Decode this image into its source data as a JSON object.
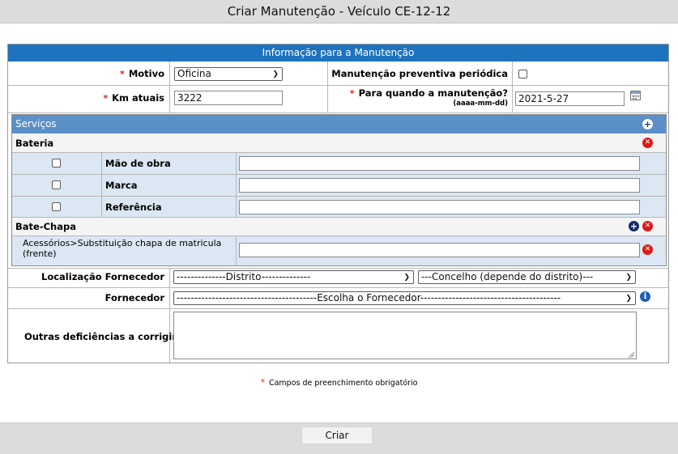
{
  "title": "Criar Manutenção - Veículo CE-12-12",
  "section_header": "Informação para a Manutenção",
  "required_mark": "*",
  "motivo": {
    "label": "Motivo",
    "value": "Oficina"
  },
  "preventiva": {
    "label": "Manutenção preventiva periódica",
    "checked": false
  },
  "km": {
    "label": "Km atuais",
    "value": "3222"
  },
  "data_prevista": {
    "label": "Para quando a manutenção?",
    "format_hint": "(aaaa-mm-dd)",
    "value": "2021-5-27"
  },
  "servicos": {
    "header": "Serviços",
    "groups": [
      {
        "name": "Bateria",
        "items": [
          {
            "label": "Mão de obra",
            "value": ""
          },
          {
            "label": "Marca",
            "value": ""
          },
          {
            "label": "Referência",
            "value": ""
          }
        ]
      },
      {
        "name": "Bate-Chapa",
        "items": [
          {
            "label": "Acessórios>Substituição chapa de matricula (frente)",
            "value": ""
          }
        ]
      }
    ]
  },
  "localizacao": {
    "label": "Localização Fornecedor",
    "distrito": "--------------Distrito--------------",
    "concelho": "---Concelho (depende do distrito)---"
  },
  "fornecedor": {
    "label": "Fornecedor",
    "value": "----------------------------------------Escolha o Fornecedor----------------------------------------"
  },
  "outras": {
    "label": "Outras deficiências a corrigir",
    "value": ""
  },
  "required_note": "Campos de preenchimento obrigatório",
  "submit_label": "Criar",
  "colors": {
    "header_blue": "#1e73be",
    "services_blue": "#5b8fc7",
    "row_bg": "#dbe7f3",
    "required_red": "#e02020",
    "remove_red": "#e01818",
    "add_navy": "#162a66"
  }
}
